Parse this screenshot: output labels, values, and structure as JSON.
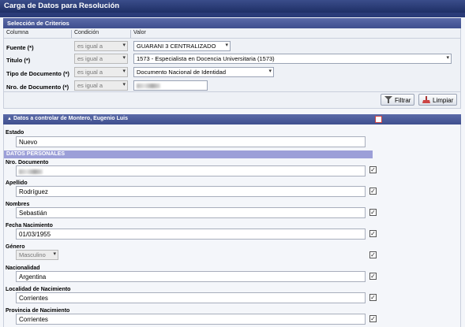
{
  "window": {
    "title": "Carga de Datos para Resolución"
  },
  "criteria": {
    "header": "Selección de Criterios",
    "columns": {
      "column": "Columna",
      "condition": "Condición",
      "value": "Valor"
    },
    "rows": [
      {
        "label": "Fuente (*)",
        "condition": "es igual a",
        "value": "GUARANI 3 CENTRALIZADO"
      },
      {
        "label": "Titulo (*)",
        "condition": "es igual a",
        "value": "1573 - Especialista en Docencia Universitaria (1573)"
      },
      {
        "label": "Tipo de Documento (*)",
        "condition": "es igual a",
        "value": "Documento Nacional de Identidad"
      },
      {
        "label": "Nro. de Documento (*)",
        "condition": "es igual a",
        "value": ""
      }
    ],
    "filter_button": "Filtrar",
    "clear_button": "Limpiar"
  },
  "data": {
    "header": "Datos a controlar de Montero, Eugenio Luis",
    "estado": {
      "label": "Estado",
      "value": "Nuevo"
    },
    "section_title": "DATOS PERSONALES",
    "fields": [
      {
        "label": "Nro. Documento",
        "value": "",
        "checked": true
      },
      {
        "label": "Apellido",
        "value": "Rodríguez",
        "checked": true
      },
      {
        "label": "Nombres",
        "value": "Sebastián",
        "checked": true
      },
      {
        "label": "Fecha Nacimiento",
        "value": "01/03/1955",
        "checked": true
      },
      {
        "label": "Género",
        "value": "Masculino",
        "checked": true
      },
      {
        "label": "Nacionalidad",
        "value": "Argentina",
        "checked": true
      },
      {
        "label": "Localidad de Nacimiento",
        "value": "Corrientes",
        "checked": true
      },
      {
        "label": "Provincia de Nacimiento",
        "value": "Corrientes",
        "checked": true
      }
    ]
  },
  "colors": {
    "title_bar": "#2a3b78",
    "panel_header": "#4a5a9a",
    "section": "#9c9fd8"
  }
}
